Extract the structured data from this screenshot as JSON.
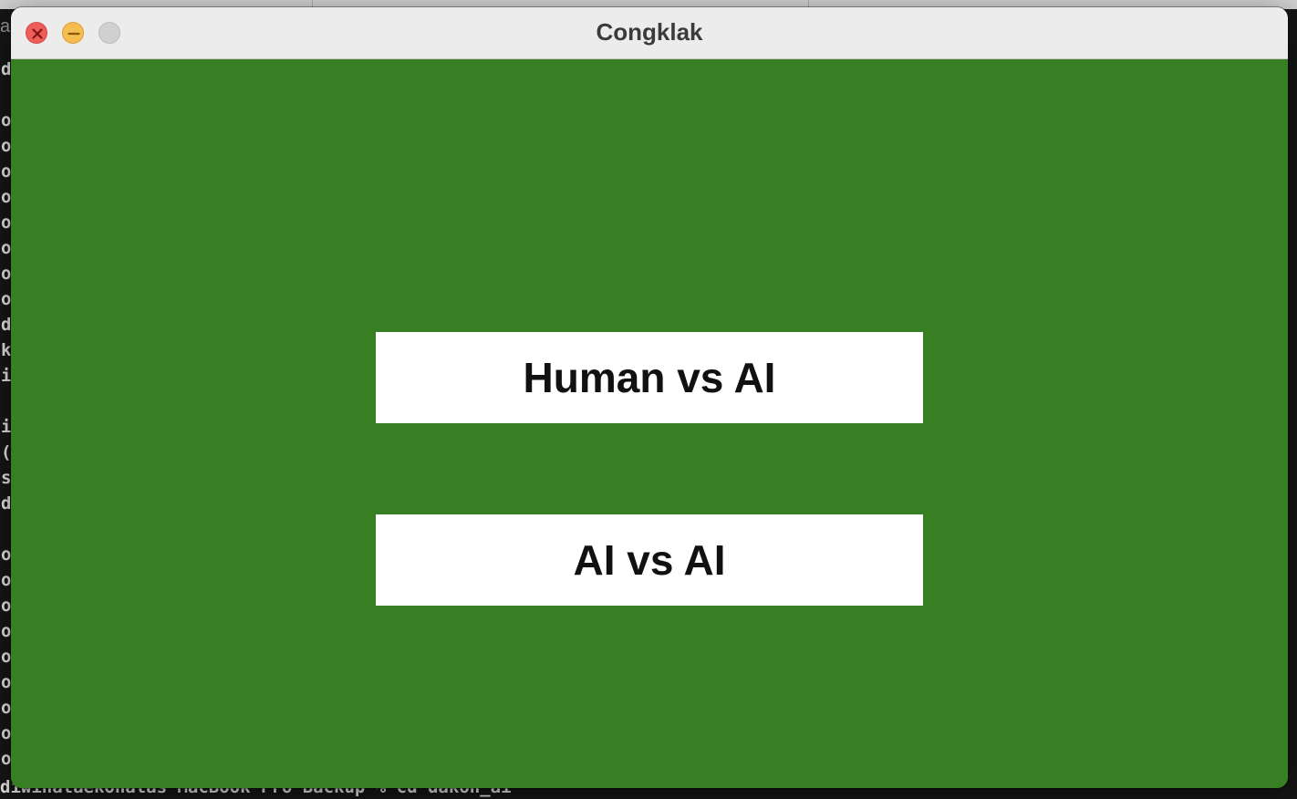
{
  "window": {
    "title": "Congklak"
  },
  "menu": {
    "human_vs_ai_label": "Human vs AI",
    "ai_vs_ai_label": "AI vs AI"
  },
  "background_terminal": {
    "top_label": "as",
    "left_column_chars": [
      "d",
      "",
      "o",
      "o",
      "o",
      "o",
      "o",
      "o",
      "o",
      "o",
      "d",
      "k",
      "i",
      "",
      "i",
      "(",
      "s",
      "d",
      "",
      "o",
      "o",
      "o",
      "o",
      "o",
      "o",
      "o",
      "o",
      "o"
    ],
    "bottom_line": "diwinataekonatas MacBook Pro Backup % cd dakon_ai"
  },
  "colors": {
    "board_green": "#387f24",
    "button_white": "#ffffff",
    "titlebar": "#ececec",
    "close": "#ee5d58",
    "minimize": "#f5bd4f",
    "zoom_disabled": "#d0d0d0"
  },
  "icons": {
    "close": "close-icon",
    "minimize": "minimize-icon",
    "zoom": "zoom-icon"
  }
}
